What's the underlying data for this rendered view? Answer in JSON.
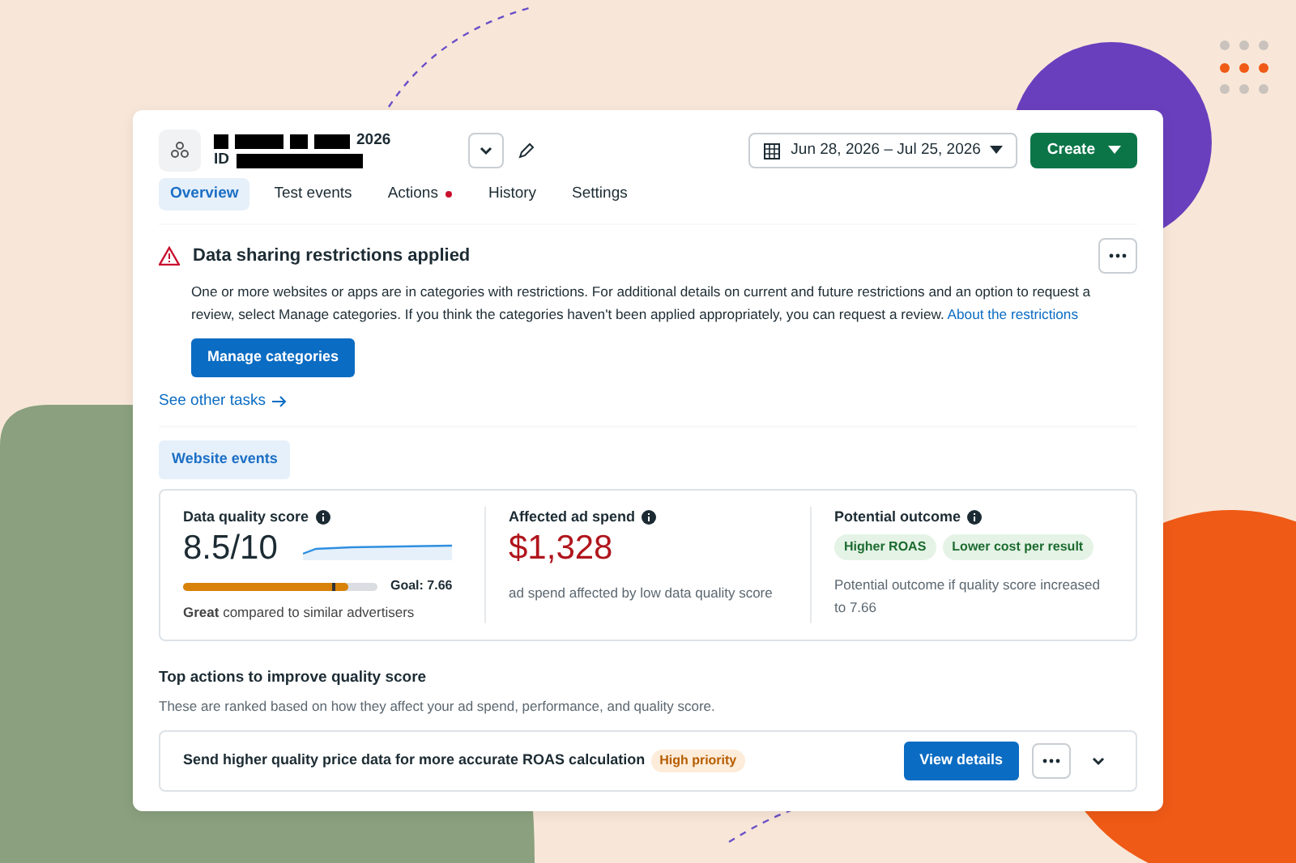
{
  "header": {
    "name_suffix": "2026",
    "id_label": "ID",
    "date_range": "Jun 28, 2026 – Jul 25, 2026",
    "create_button": "Create"
  },
  "tabs": [
    {
      "label": "Overview",
      "selected": true,
      "dot": false
    },
    {
      "label": "Test events",
      "selected": false,
      "dot": false
    },
    {
      "label": "Actions",
      "selected": false,
      "dot": true
    },
    {
      "label": "History",
      "selected": false,
      "dot": false
    },
    {
      "label": "Settings",
      "selected": false,
      "dot": false
    }
  ],
  "alert": {
    "title": "Data sharing restrictions applied",
    "body": "One or more websites or apps are in categories with restrictions. For additional details on current and future restrictions and an option to request a review, select Manage categories.  If you think the categories haven't been applied appropriately, you can request a review.",
    "link": "About the restrictions",
    "button": "Manage categories",
    "more_link": "See other tasks"
  },
  "filter": {
    "label": "Website events",
    "selected": true
  },
  "metrics": [
    {
      "kind": "score",
      "title": "Data quality score",
      "value": "8.5/10",
      "level": 0.85,
      "goal": "Goal: 7.66",
      "caption": "**Great** compared to similar advertisers"
    },
    {
      "kind": "spend",
      "title": "Affected ad spend",
      "value": "$1,328",
      "caption": "ad spend affected by low data quality score"
    },
    {
      "kind": "outcome",
      "title": "Potential outcome",
      "tags": [
        "Higher ROAS",
        "Lower cost per result"
      ],
      "caption": "Potential outcome if quality score increased to 7.66"
    }
  ],
  "top_actions": {
    "title": "Top actions to improve quality score",
    "subtitle": "These are ranked based on how they affect your ad spend, performance, and quality score.",
    "items": [
      {
        "title": "Send higher quality price data for more accurate ROAS calculation",
        "badge": "High priority",
        "button": "View details"
      }
    ]
  }
}
